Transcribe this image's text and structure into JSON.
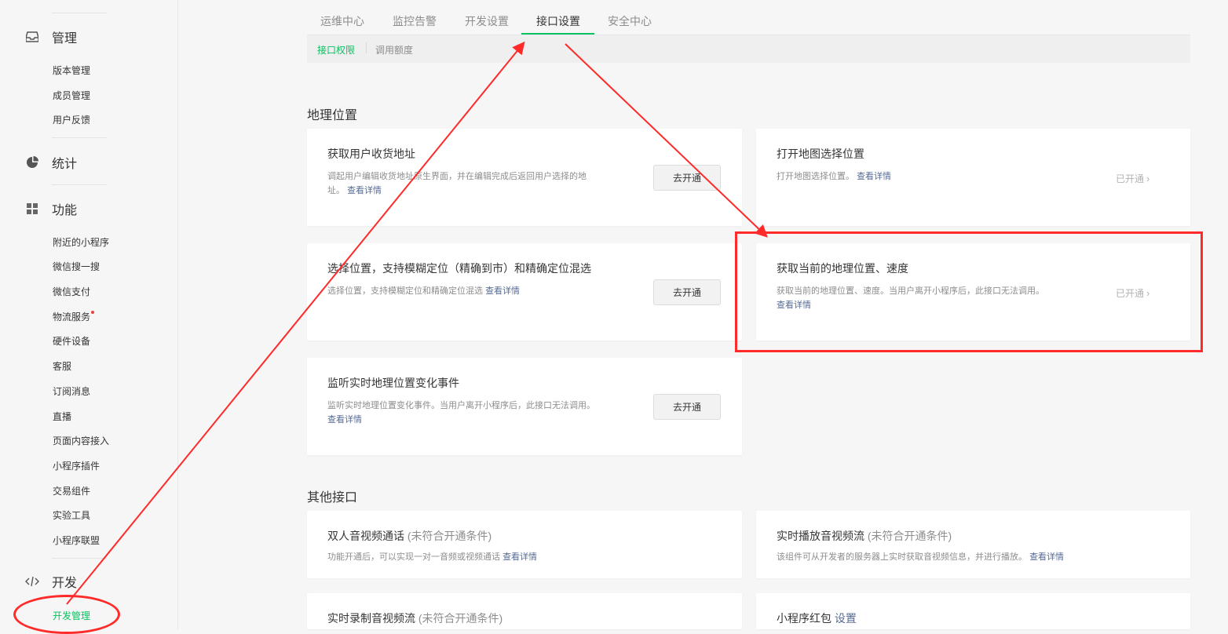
{
  "sidebar": {
    "groups": {
      "manage": {
        "label": "管理",
        "icon": "inbox-icon"
      },
      "stats": {
        "label": "统计",
        "icon": "pie-chart-icon"
      },
      "functions": {
        "label": "功能",
        "icon": "grid-icon"
      },
      "dev": {
        "label": "开发",
        "icon": "code-icon"
      }
    },
    "manage_items": [
      "版本管理",
      "成员管理",
      "用户反馈"
    ],
    "function_items": [
      "附近的小程序",
      "微信搜一搜",
      "微信支付",
      "物流服务",
      "硬件设备",
      "客服",
      "订阅消息",
      "直播",
      "页面内容接入",
      "小程序插件",
      "交易组件",
      "实验工具",
      "小程序联盟"
    ],
    "dev_items": [
      "开发管理"
    ],
    "active_item": "开发管理"
  },
  "tabs": [
    "运维中心",
    "监控告警",
    "开发设置",
    "接口设置",
    "安全中心"
  ],
  "active_tab": "接口设置",
  "subtabs": [
    "接口权限",
    "调用额度"
  ],
  "active_subtab": "接口权限",
  "sections": {
    "geo": {
      "title": "地理位置",
      "cards": [
        {
          "title": "获取用户收货地址",
          "desc1": "调起用户编辑收货地址原生界面，并在编辑完成后返回用户选择的地",
          "desc2": "址。",
          "link": "查看详情",
          "button": "去开通"
        },
        {
          "title": "打开地图选择位置",
          "desc1": "打开地图选择位置。",
          "link": "查看详情",
          "status": "已开通"
        },
        {
          "title": "选择位置，支持模糊定位（精确到市）和精确定位混选",
          "desc1": "选择位置，支持模糊定位和精确定位混选",
          "link": "查看详情",
          "button": "去开通"
        },
        {
          "title": "获取当前的地理位置、速度",
          "desc1": "获取当前的地理位置、速度。当用户离开小程序后，此接口无法调用。",
          "link": "查看详情",
          "status": "已开通"
        },
        {
          "title": "监听实时地理位置变化事件",
          "desc1": "监听实时地理位置变化事件。当用户离开小程序后，此接口无法调用。",
          "link": "查看详情",
          "button": "去开通"
        }
      ]
    },
    "other": {
      "title": "其他接口",
      "cards": [
        {
          "title": "双人音视频通话",
          "note": "(未符合开通条件)",
          "desc1": "功能开通后，可以实现一对一音频或视频通话",
          "link": "查看详情"
        },
        {
          "title": "实时播放音视频流",
          "note": "(未符合开通条件)",
          "desc1": "该组件可从开发者的服务器上实时获取音视频信息，并进行播放。",
          "link": "查看详情"
        },
        {
          "title": "实时录制音视频流",
          "note": "(未符合开通条件)"
        },
        {
          "title": "小程序红包",
          "link": "设置"
        }
      ]
    }
  },
  "colors": {
    "accent": "#07c160",
    "link": "#576b95",
    "annotation": "#ff2a2a"
  }
}
